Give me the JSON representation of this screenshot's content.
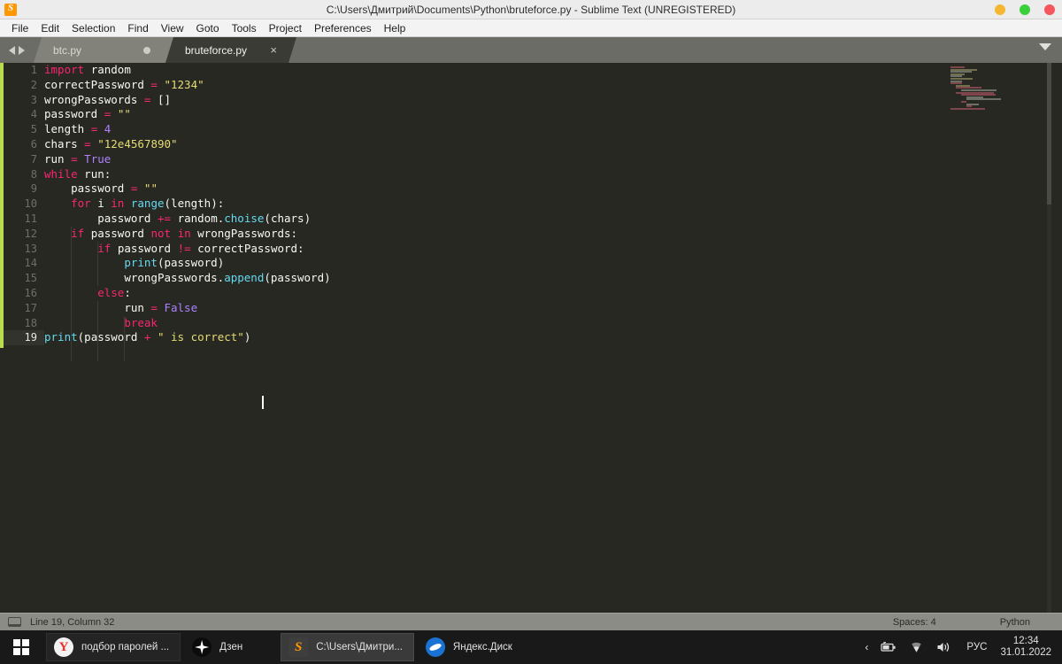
{
  "titlebar": {
    "title": "C:\\Users\\Дмитрий\\Documents\\Python\\bruteforce.py - Sublime Text (UNREGISTERED)",
    "app_icon": "sublime-text-icon",
    "controls": [
      {
        "name": "minimize-button",
        "color": "#f5b632"
      },
      {
        "name": "maximize-button",
        "color": "#3ccf3c"
      },
      {
        "name": "close-button",
        "color": "#f5555c"
      }
    ]
  },
  "menubar": {
    "items": [
      {
        "label": "File"
      },
      {
        "label": "Edit"
      },
      {
        "label": "Selection"
      },
      {
        "label": "Find"
      },
      {
        "label": "View"
      },
      {
        "label": "Goto"
      },
      {
        "label": "Tools"
      },
      {
        "label": "Project"
      },
      {
        "label": "Preferences"
      },
      {
        "label": "Help"
      }
    ]
  },
  "tabbar": {
    "tabs": [
      {
        "label": "btc.py",
        "active": false,
        "dirty": true
      },
      {
        "label": "bruteforce.py",
        "active": true,
        "close_glyph": "×"
      }
    ],
    "overflow_icon": "chevron-down-icon"
  },
  "editor": {
    "current_line": 19,
    "total_lines": 19,
    "line_numbers": [
      "1",
      "2",
      "3",
      "4",
      "5",
      "6",
      "7",
      "8",
      "9",
      "10",
      "11",
      "12",
      "13",
      "14",
      "15",
      "16",
      "17",
      "18",
      "19"
    ],
    "lines": [
      {
        "n": 1,
        "text": "import random"
      },
      {
        "n": 2,
        "text": "correctPassword = \"1234\""
      },
      {
        "n": 3,
        "text": "wrongPasswords = []"
      },
      {
        "n": 4,
        "text": "password = \"\""
      },
      {
        "n": 5,
        "text": "length = 4"
      },
      {
        "n": 6,
        "text": "chars = \"12e4567890\""
      },
      {
        "n": 7,
        "text": "run = True"
      },
      {
        "n": 8,
        "text": "while run:"
      },
      {
        "n": 9,
        "text": "    password = \"\""
      },
      {
        "n": 10,
        "text": "    for i in range(length):"
      },
      {
        "n": 11,
        "text": "        password += random.choise(chars)"
      },
      {
        "n": 12,
        "text": "    if password not in wrongPasswords:"
      },
      {
        "n": 13,
        "text": "        if password != correctPassword:"
      },
      {
        "n": 14,
        "text": "            print(password)"
      },
      {
        "n": 15,
        "text": "            wrongPasswords.append(password)"
      },
      {
        "n": 16,
        "text": "        else:"
      },
      {
        "n": 17,
        "text": "            run = False"
      },
      {
        "n": 18,
        "text": "            break"
      },
      {
        "n": 19,
        "text": "print(password + \" is correct\")"
      }
    ],
    "colors": {
      "background": "#272822",
      "keyword": "#f92672",
      "function": "#66d9ef",
      "string": "#e6db74",
      "number": "#ae81ff",
      "identifier": "#f8f8f2",
      "gutter_text": "#6e7066",
      "accent_bar": "#b9dd4e"
    }
  },
  "statusbar": {
    "panel_icon": "console-panel-icon",
    "position": "Line 19, Column 32",
    "spaces": "Spaces: 4",
    "syntax": "Python"
  },
  "taskbar": {
    "start_icon": "windows-start-icon",
    "tasks": [
      {
        "label": "подбор паролей ...",
        "icon": "yandex-browser-icon",
        "active": false
      },
      {
        "label": "Дзен",
        "icon": "dzen-icon",
        "active": false
      },
      {
        "label": "C:\\Users\\Дмитри...",
        "icon": "sublime-text-icon",
        "active": true
      },
      {
        "label": "Яндекс.Диск",
        "icon": "yandex-disk-icon",
        "active": false
      }
    ],
    "tray": {
      "chevron": "‹",
      "battery_icon": "battery-icon",
      "wifi_icon": "wifi-icon",
      "volume_icon": "volume-icon",
      "language": "РУС",
      "time": "12:34",
      "date": "31.01.2022"
    }
  }
}
